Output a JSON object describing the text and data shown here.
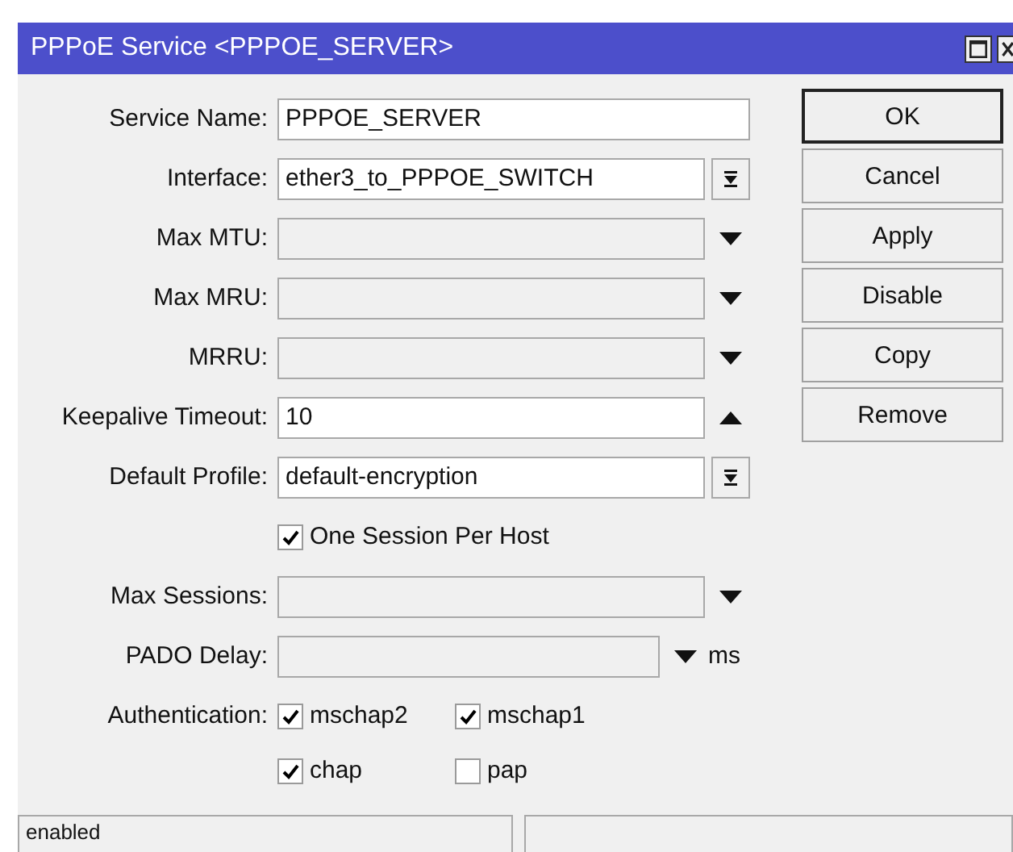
{
  "window": {
    "title": "PPPoE Service <PPPOE_SERVER>"
  },
  "fields": [
    {
      "label": "Service Name:",
      "kind": "text",
      "value": "PPPOE_SERVER"
    },
    {
      "label": "Interface:",
      "kind": "select",
      "value": "ether3_to_PPPOE_SWITCH"
    },
    {
      "label": "Max MTU:",
      "kind": "optional",
      "expanded": false
    },
    {
      "label": "Max MRU:",
      "kind": "optional",
      "expanded": false
    },
    {
      "label": "MRRU:",
      "kind": "optional",
      "expanded": false
    },
    {
      "label": "Keepalive Timeout:",
      "kind": "optional",
      "expanded": true,
      "value": "10"
    },
    {
      "label": "Default Profile:",
      "kind": "select",
      "value": "default-encryption"
    },
    {
      "label": "One Session Per Host",
      "kind": "checkbox",
      "checked": true
    },
    {
      "label": "Max Sessions:",
      "kind": "optional",
      "expanded": false
    },
    {
      "label": "PADO Delay:",
      "kind": "optional",
      "expanded": false,
      "unit": "ms"
    }
  ],
  "authentication": {
    "label": "Authentication:",
    "options": [
      {
        "label": "mschap2",
        "checked": true
      },
      {
        "label": "mschap1",
        "checked": true
      },
      {
        "label": "chap",
        "checked": true
      },
      {
        "label": "pap",
        "checked": false
      }
    ]
  },
  "buttons": [
    {
      "label": "OK",
      "default": true
    },
    {
      "label": "Cancel",
      "default": false
    },
    {
      "label": "Apply",
      "default": false
    },
    {
      "label": "Disable",
      "default": false
    },
    {
      "label": "Copy",
      "default": false
    },
    {
      "label": "Remove",
      "default": false
    }
  ],
  "status_bar": [
    "enabled"
  ]
}
